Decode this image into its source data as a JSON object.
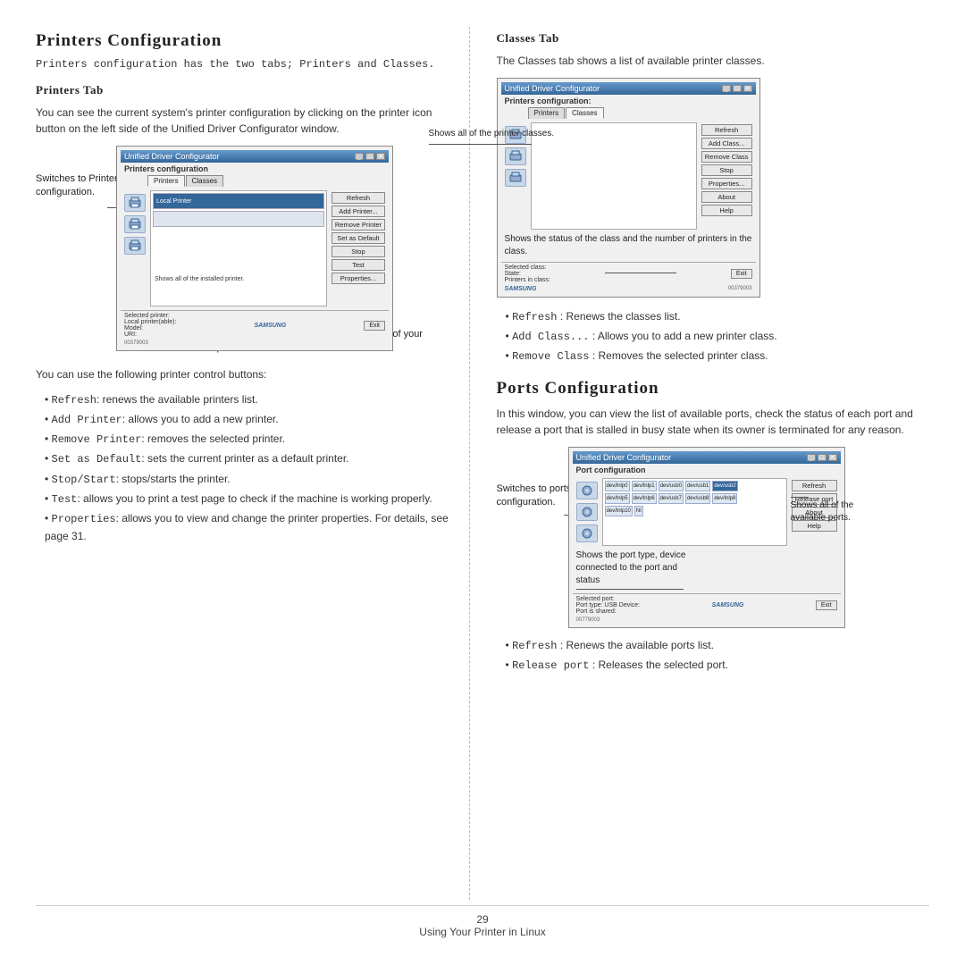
{
  "page": {
    "left_section_title": "Printers Configuration",
    "left_intro": "Printers configuration has the two tabs; Printers and Classes.",
    "printers_tab_title": "Printers Tab",
    "printers_tab_body": "You can see the current system's printer configuration by clicking on the printer icon button on the left side of the Unified Driver Configurator window.",
    "printer_buttons_note": "You can use the following printer control buttons:",
    "printer_bullets": [
      "Refresh: renews the available printers list.",
      "Add Printer: allows you to add a new printer.",
      "Remove Printer: removes the selected printer.",
      "Set as Default: sets the current printer as a default printer.",
      "Stop/Start: stops/starts the printer.",
      "Test: allows you to print a test page to check if the machine is working properly.",
      "Properties: allows you to view and change the printer properties. For details, see page 31."
    ],
    "right_section_title": "Classes Tab",
    "classes_tab_title": "Classes Tab",
    "classes_tab_body": "The Classes tab shows a list of available printer classes.",
    "classes_bullets": [
      "Refresh : Renews the classes list.",
      "Add Class... : Allows you to add a new printer class.",
      "Remove Class : Removes the selected printer class."
    ],
    "ports_section_title": "Ports Configuration",
    "ports_body": "In this window, you can view the list of available ports, check the status of each port and release a port that is stalled in busy state when its owner is terminated for any reason.",
    "ports_bullets": [
      "Refresh : Renews the available ports list.",
      "Release port : Releases the selected port."
    ],
    "footer_page_number": "29",
    "footer_text": "Using Your Printer in Linux"
  },
  "screenshots": {
    "printers": {
      "titlebar": "Unified Driver Configurator",
      "label": "Printers configuration",
      "tabs": [
        "Printers",
        "Classes"
      ],
      "active_tab": "Printers",
      "buttons": [
        "Refresh",
        "Add Printer...",
        "Remove Printer",
        "Set as Default",
        "Stop",
        "Test",
        "Properties..."
      ],
      "list_label": "Shows all of the installed printer.",
      "status_label": "Shows the status, model name and URI of your printer.",
      "callout_switches": "Switches to Printer configuration.",
      "status_fields": [
        "Selected printer:",
        "Local printer(able):",
        "Model:",
        "URI:"
      ],
      "samsung_logo": "SAMSUNG",
      "exit_btn": "Exit"
    },
    "classes": {
      "titlebar": "Unified Driver Configurator",
      "label": "Printers configuration:",
      "tabs": [
        "Printers",
        "Classes"
      ],
      "active_tab": "Classes",
      "buttons": [
        "Refresh",
        "Add Class...",
        "Remove Class",
        "Stop",
        "Properties...",
        "About",
        "Help"
      ],
      "list_label": "Shows all of the printer classes.",
      "status_label": "Shows the status of the class and the number of printers in the class.",
      "status_fields": [
        "Selected class:",
        "State:",
        "Printers in class:"
      ],
      "samsung_logo": "SAMSUNG",
      "exit_btn": "Exit"
    },
    "ports": {
      "titlebar": "Unified Driver Configurator",
      "label": "Port configuration",
      "buttons": [
        "Refresh",
        "Release port",
        "About",
        "Help"
      ],
      "callout_switches": "Switches to ports configuration.",
      "callout_shows": "Shows all of the available ports.",
      "callout_port_info": "Shows the port type, device connected to the port and status",
      "ports_row1": [
        "dev/lnlp0",
        "dev/lnlp1",
        "dev/usb0",
        "dev/usb1",
        "dev/usb2"
      ],
      "ports_row2": [
        "dev/lnlp5",
        "dev/lnlp6",
        "dev/usb7",
        "dev/usb8",
        "dev/lnlp8"
      ],
      "ports_row3": [
        "dev/lnlp10",
        "NI"
      ],
      "selected_port": "dev/usb2",
      "status_fields": [
        "Selected port:",
        "Port type: USB Device:",
        "Port is shared:"
      ],
      "samsung_logo": "SAMSUNG",
      "exit_btn": "Exit"
    }
  },
  "callouts": {
    "switches_printer": "Switches to Printer\nconfiguration.",
    "shows_installed": "Shows all of the\ninstalled printer.",
    "shows_status": "Shows the status,\nmodel name and\nURI of your printer.",
    "shows_classes": "Shows all of the\nprinter classes.",
    "shows_class_status": "Shows the status of the\nclass and the number of\nprinters in the class.",
    "switches_ports": "Switches to\nports\nconfiguration.",
    "shows_ports": "Shows all of the\navailable ports.",
    "shows_port_info": "Shows the port type,\ndevice connected to\nthe port and status"
  }
}
